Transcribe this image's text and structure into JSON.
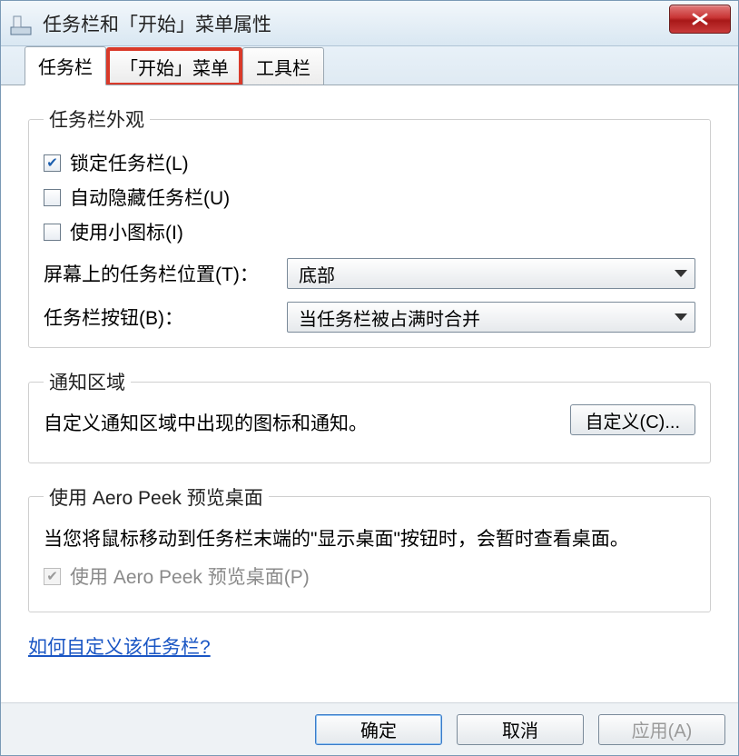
{
  "window": {
    "title": "任务栏和「开始」菜单属性"
  },
  "tabs": [
    {
      "label": "任务栏",
      "active": true
    },
    {
      "label": "「开始」菜单",
      "highlight": true
    },
    {
      "label": "工具栏"
    }
  ],
  "appearance": {
    "legend": "任务栏外观",
    "lock": {
      "label": "锁定任务栏(L)",
      "checked": true
    },
    "autohide": {
      "label": "自动隐藏任务栏(U)",
      "checked": false
    },
    "smallicons": {
      "label": "使用小图标(I)",
      "checked": false
    },
    "position": {
      "label": "屏幕上的任务栏位置(T)：",
      "value": "底部"
    },
    "buttons": {
      "label": "任务栏按钮(B)：",
      "value": "当任务栏被占满时合并"
    }
  },
  "notify": {
    "legend": "通知区域",
    "desc": "自定义通知区域中出现的图标和通知。",
    "button": "自定义(C)..."
  },
  "aero": {
    "legend": "使用 Aero Peek 预览桌面",
    "desc": "当您将鼠标移动到任务栏末端的\"显示桌面\"按钮时，会暂时查看桌面。",
    "checkbox": {
      "label": "使用 Aero Peek 预览桌面(P)",
      "checked": true,
      "disabled": true
    }
  },
  "help_link": "如何自定义该任务栏?",
  "footer": {
    "ok": "确定",
    "cancel": "取消",
    "apply": "应用(A)"
  }
}
